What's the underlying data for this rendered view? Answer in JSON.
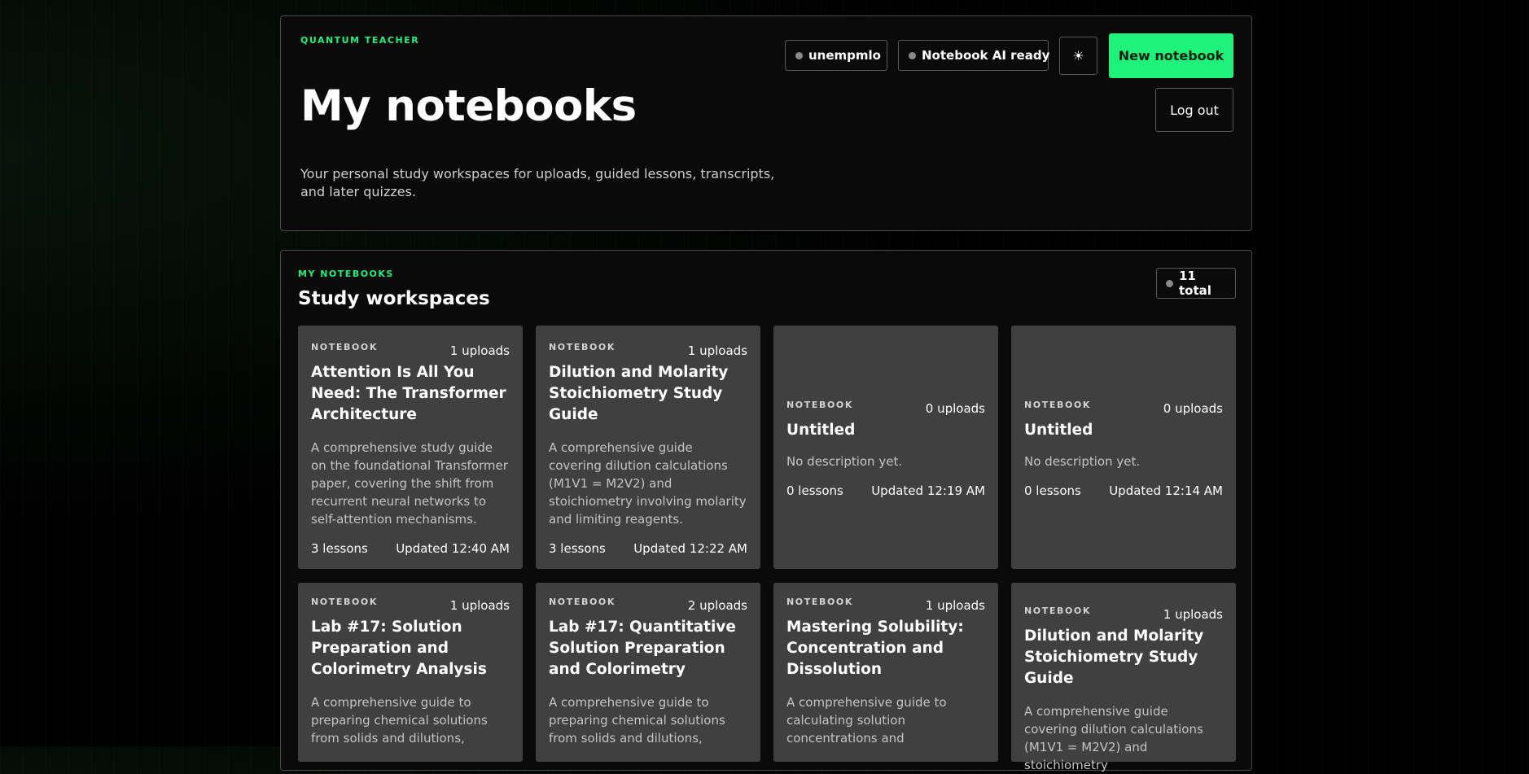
{
  "header": {
    "eyebrow": "QUANTUM TEACHER",
    "title": "My notebooks",
    "description": "Your personal study workspaces for uploads, guided lessons, transcripts, and later quizzes.",
    "username": "unempmlo",
    "ai_status": "Notebook AI ready",
    "theme_icon": "☀",
    "new_notebook_label": "New notebook",
    "logout_label": "Log out"
  },
  "notebooks_section": {
    "eyebrow": "MY NOTEBOOKS",
    "title": "Study workspaces",
    "total": "11 total"
  },
  "cards": [
    {
      "kicker": "NOTEBOOK",
      "uploads": "1 uploads",
      "title": "Attention Is All You Need: The Transformer Architecture",
      "description": "A comprehensive study guide on the foundational Transformer paper, covering the shift from recurrent neural networks to self-attention mechanisms.",
      "lessons": "3 lessons",
      "updated": "Updated 12:40 AM"
    },
    {
      "kicker": "NOTEBOOK",
      "uploads": "1 uploads",
      "title": "Dilution and Molarity Stoichiometry Study Guide",
      "description": "A comprehensive guide covering dilution calculations (M1V1 = M2V2) and stoichiometry involving molarity and limiting reagents.",
      "lessons": "3 lessons",
      "updated": "Updated 12:22 AM"
    },
    {
      "kicker": "NOTEBOOK",
      "uploads": "0 uploads",
      "title": "Untitled",
      "description": "No description yet.",
      "lessons": "0 lessons",
      "updated": "Updated 12:19 AM"
    },
    {
      "kicker": "NOTEBOOK",
      "uploads": "0 uploads",
      "title": "Untitled",
      "description": "No description yet.",
      "lessons": "0 lessons",
      "updated": "Updated 12:14 AM"
    },
    {
      "kicker": "NOTEBOOK",
      "uploads": "1 uploads",
      "title": "Lab #17: Solution Preparation and Colorimetry Analysis",
      "description": "A comprehensive guide to preparing chemical solutions from solids and dilutions,"
    },
    {
      "kicker": "NOTEBOOK",
      "uploads": "2 uploads",
      "title": "Lab #17: Quantitative Solution Preparation and Colorimetry",
      "description": "A comprehensive guide to preparing chemical solutions from solids and dilutions,"
    },
    {
      "kicker": "NOTEBOOK",
      "uploads": "1 uploads",
      "title": "Mastering Solubility: Concentration and Dissolution",
      "description": "A comprehensive guide to calculating solution concentrations and"
    },
    {
      "kicker": "NOTEBOOK",
      "uploads": "1 uploads",
      "title": "Dilution and Molarity Stoichiometry Study Guide",
      "description": "A comprehensive guide covering dilution calculations (M1V1 = M2V2) and stoichiometry"
    }
  ]
}
